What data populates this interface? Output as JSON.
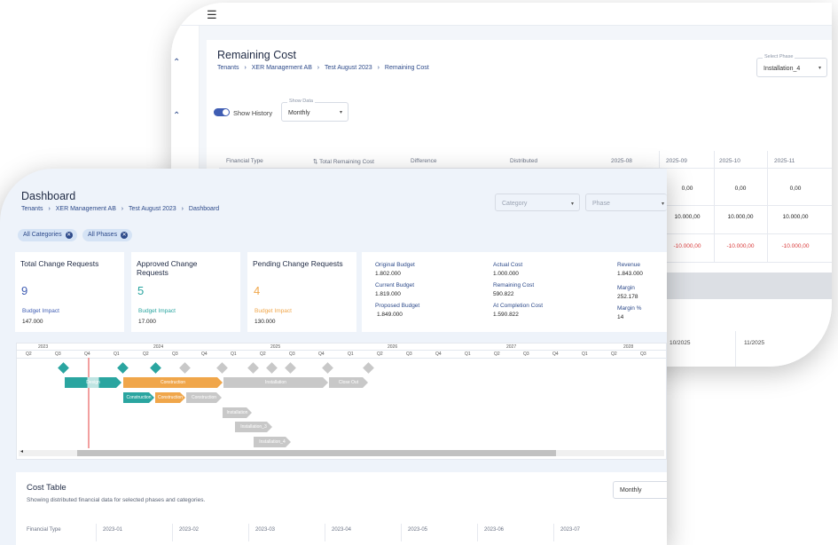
{
  "back": {
    "title": "Remaining Cost",
    "breadcrumbs": [
      "Tenants",
      "XER Management AB",
      "Test August 2023",
      "Remaining Cost"
    ],
    "phase_select": {
      "label": "Select Phase",
      "value": "Installation_4"
    },
    "show_history": {
      "label": "Show History",
      "on": true
    },
    "show_data": {
      "label": "Show Data",
      "value": "Monthly"
    },
    "table_headers": [
      "Financial Type",
      "Total Remaining Cost",
      "Difference",
      "Distributed",
      "2025-08",
      "2025-09",
      "2025-10",
      "2025-11"
    ],
    "rows": [
      [
        "0,00",
        "0,00",
        "0,00"
      ],
      [
        "10.000,00",
        "10.000,00",
        "10.000,00"
      ],
      [
        "-10.000,00",
        "-10.000,00",
        "-10.000,00"
      ]
    ],
    "bottom_periods": [
      "10/2025",
      "11/2025"
    ]
  },
  "front": {
    "title": "Dashboard",
    "breadcrumbs": [
      "Tenants",
      "XER Management AB",
      "Test August 2023",
      "Dashboard"
    ],
    "category_placeholder": "Category",
    "phase_placeholder": "Phase",
    "chips": [
      "All Categories",
      "All Phases"
    ],
    "cards": [
      {
        "title": "Total Change Requests",
        "number": "9",
        "budget_label": "Budget Impact",
        "budget_value": "147.000",
        "color": "#3f5db3"
      },
      {
        "title": "Approved Change Requests",
        "number": "5",
        "budget_label": "Budget Impact",
        "budget_value": "17.000",
        "color": "#2aa5a0"
      },
      {
        "title": "Pending Change Requests",
        "number": "4",
        "budget_label": "Budget Impact",
        "budget_value": "130.000",
        "color": "#f0a64a"
      }
    ],
    "financials": {
      "col1": [
        {
          "k": "Original Budget",
          "v": "1.802.000"
        },
        {
          "k": "Current Budget",
          "v": "1.819.000"
        },
        {
          "k": "Proposed Budget",
          "v": "1.849.000"
        }
      ],
      "col2": [
        {
          "k": "Actual Cost",
          "v": "1.000.000"
        },
        {
          "k": "Remaining Cost",
          "v": "590.822"
        },
        {
          "k": "At Completion Cost",
          "v": "1.590.822"
        }
      ],
      "col3": [
        {
          "k": "Revenue",
          "v": "1.843.000"
        },
        {
          "k": "Margin",
          "v": "252.178"
        },
        {
          "k": "Margin %",
          "v": "14"
        }
      ]
    },
    "gantt": {
      "years": [
        "2023",
        "2024",
        "2025",
        "2026",
        "2027",
        "2028"
      ],
      "quarters": [
        "Q2",
        "Q3",
        "Q4",
        "Q1",
        "Q2",
        "Q3",
        "Q4",
        "Q1",
        "Q2",
        "Q3",
        "Q4",
        "Q1",
        "Q2",
        "Q3",
        "Q4",
        "Q1",
        "Q2",
        "Q3",
        "Q4",
        "Q1",
        "Q2",
        "Q3"
      ],
      "bars": [
        {
          "label": "Design",
          "color": "#2aa5a0"
        },
        {
          "label": "Construction",
          "color": "#f0a64a"
        },
        {
          "label": "Installation",
          "color": "#c8c8c8"
        },
        {
          "label": "Close Out",
          "color": "#c8c8c8"
        },
        {
          "label": "Construction",
          "color": "#2aa5a0"
        },
        {
          "label": "Construction",
          "color": "#f0a64a"
        },
        {
          "label": "Construction",
          "color": "#c8c8c8"
        },
        {
          "label": "Installation",
          "color": "#c8c8c8"
        },
        {
          "label": "Installation_3",
          "color": "#c8c8c8"
        },
        {
          "label": "Installation_4",
          "color": "#c8c8c8"
        }
      ],
      "milestone_colors": [
        "#2aa5a0",
        "#2aa5a0",
        "#2aa5a0",
        "#c8c8c8",
        "#c8c8c8",
        "#c8c8c8",
        "#c8c8c8",
        "#c8c8c8",
        "#c8c8c8",
        "#c8c8c8"
      ]
    },
    "cost_table": {
      "title": "Cost Table",
      "subtitle": "Showing distributed financial data for selected phases and categories.",
      "period": "Monthly",
      "headers": [
        "Financial Type",
        "2023-01",
        "2023-02",
        "2023-03",
        "2023-04",
        "2023-05",
        "2023-06",
        "2023-07"
      ]
    }
  }
}
